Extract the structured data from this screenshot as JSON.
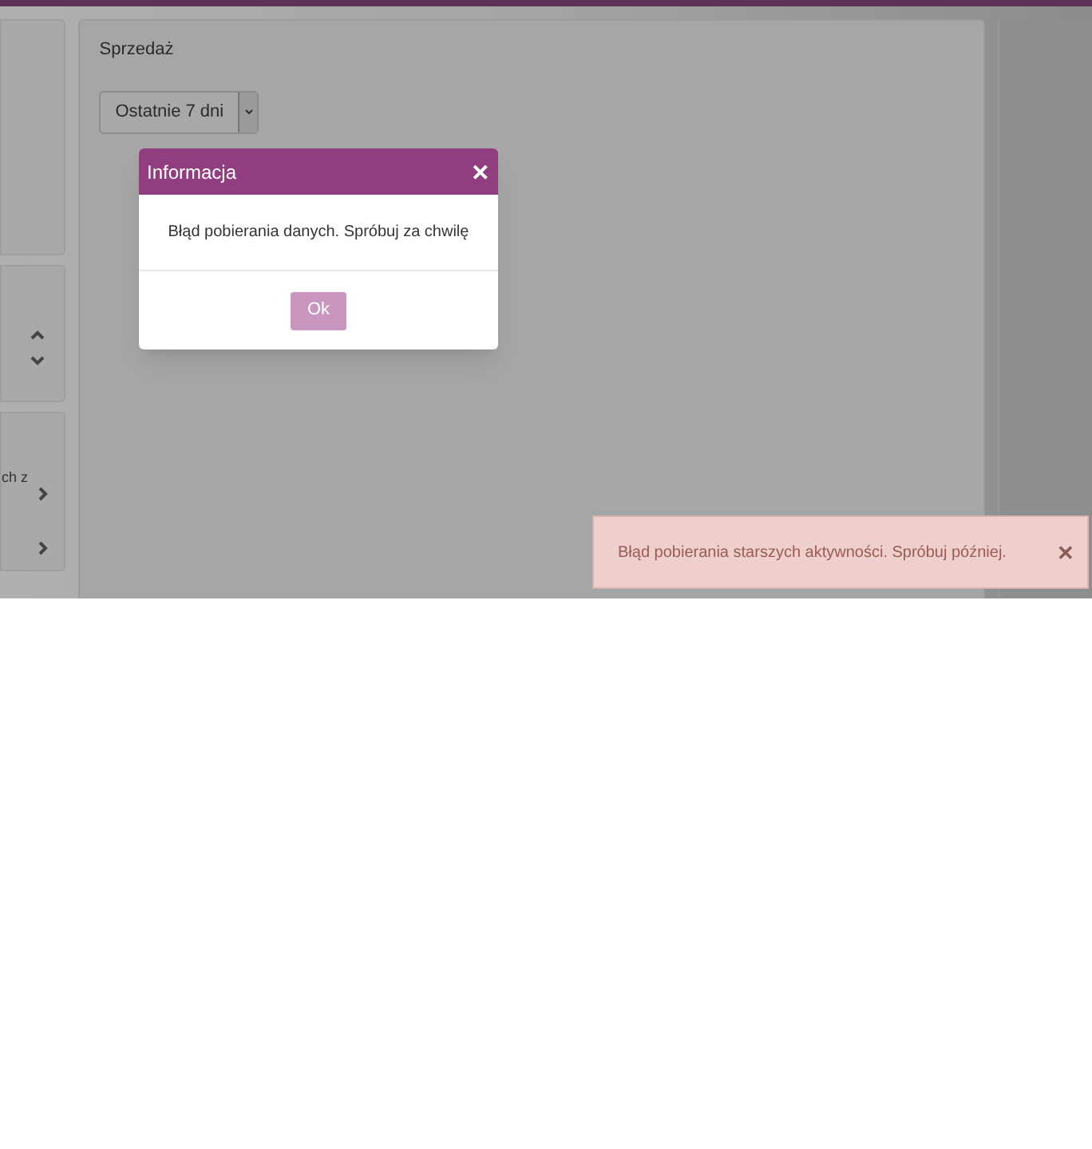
{
  "panel": {
    "title": "Sprzedaż",
    "period_select": {
      "value": "Ostatnie 7 dni"
    }
  },
  "sidebar": {
    "cut_text": "ch z"
  },
  "dialog": {
    "title": "Informacja",
    "close": "✕",
    "message": "Błąd pobierania danych. Spróbuj za chwilę",
    "button": "Ok"
  },
  "toast": {
    "message": "Błąd pobierania starszych aktywności. Spróbuj później.",
    "close": "✕"
  }
}
